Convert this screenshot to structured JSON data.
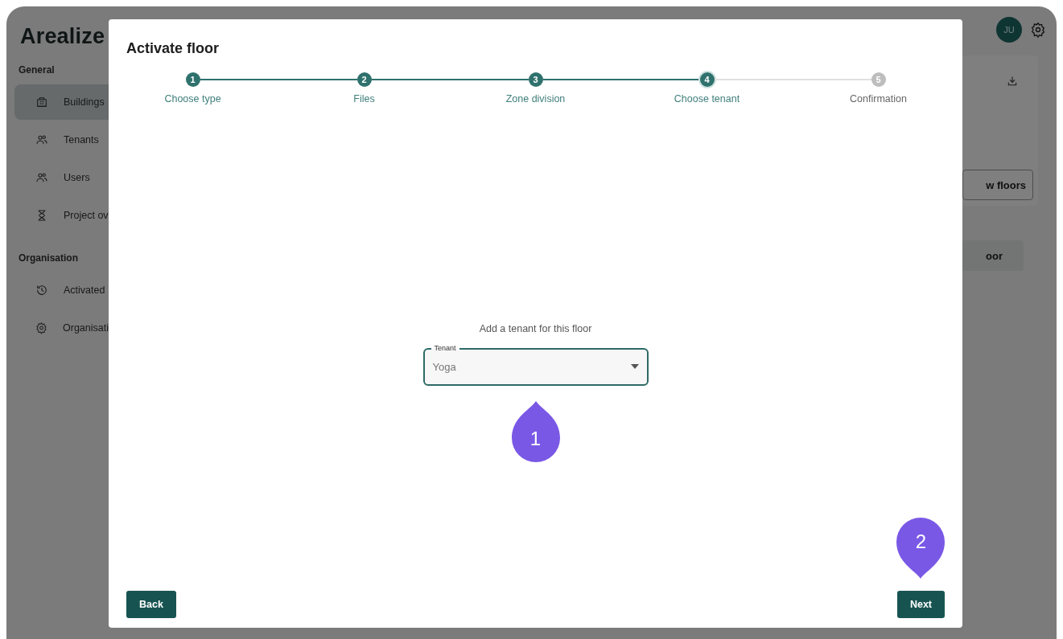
{
  "app": {
    "logo": "Arealize",
    "sidebar": [
      {
        "title": "General",
        "items": [
          {
            "label": "Buildings",
            "kind": "building",
            "selected": true
          },
          {
            "label": "Tenants",
            "kind": "people",
            "selected": false
          },
          {
            "label": "Users",
            "kind": "people",
            "selected": false
          },
          {
            "label": "Project ov",
            "kind": "hourglass",
            "selected": false
          }
        ]
      },
      {
        "title": "Organisation",
        "items": [
          {
            "label": "Activated",
            "kind": "history",
            "selected": false
          },
          {
            "label": "Organisati",
            "kind": "gear",
            "selected": false
          }
        ]
      }
    ],
    "avatar": "JU",
    "card_button": "w floors",
    "floor_button": "oor"
  },
  "dialog": {
    "title": "Activate floor",
    "steps": [
      {
        "number": "1",
        "label": "Choose type",
        "done": true,
        "selected": false
      },
      {
        "number": "2",
        "label": "Files",
        "done": true,
        "selected": false
      },
      {
        "number": "3",
        "label": "Zone division",
        "done": true,
        "selected": false
      },
      {
        "number": "4",
        "label": "Choose tenant",
        "done": false,
        "selected": true
      },
      {
        "number": "5",
        "label": "Confirmation",
        "done": false,
        "selected": false
      }
    ],
    "prompt": "Add a tenant for this floor",
    "tenant_field": {
      "label": "Tenant",
      "value": "Yoga"
    },
    "back_button": "Back",
    "next_button": "Next"
  },
  "callouts": [
    {
      "label": "1",
      "kind": "up"
    },
    {
      "label": "2",
      "kind": "down"
    }
  ]
}
